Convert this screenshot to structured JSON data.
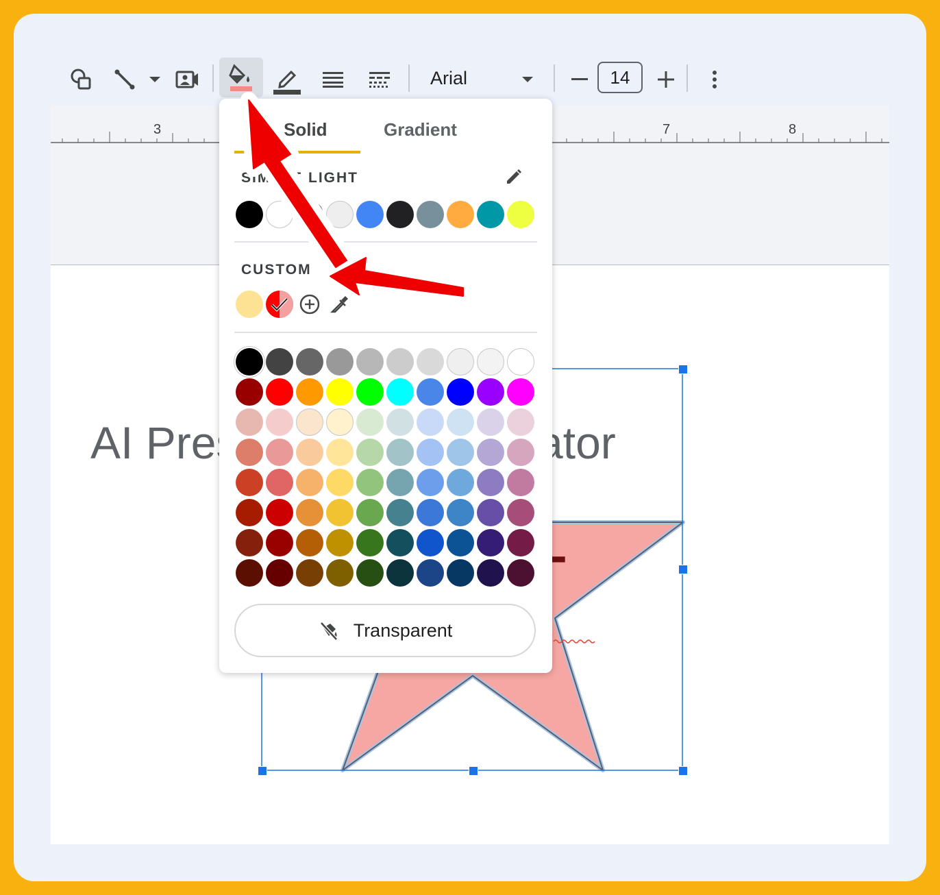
{
  "toolbar": {
    "font_family": "Arial",
    "font_size": "14"
  },
  "ruler": {
    "labels": [
      "3",
      "7",
      "8"
    ]
  },
  "slide": {
    "title": "AI Presentation Generator",
    "shape_text": "T",
    "shape_fill": "#f6a7a3"
  },
  "fill_menu": {
    "tabs": [
      "Solid",
      "Gradient"
    ],
    "active_tab": "Solid",
    "theme_label": "SIMPLE LIGHT",
    "theme_colors": [
      "#000000",
      "#ffffff",
      "#ffffff",
      "#eeeeee",
      "#4285f4",
      "#212124",
      "#78909c",
      "#ffab40",
      "#0097a7",
      "#eeff41"
    ],
    "custom_label": "CUSTOM",
    "custom_colors": [
      "#fde293",
      "#ff0000"
    ],
    "palette": [
      [
        "#000000",
        "#434343",
        "#666666",
        "#999999",
        "#b7b7b7",
        "#cccccc",
        "#d9d9d9",
        "#efefef",
        "#f3f3f3",
        "#ffffff"
      ],
      [
        "#980000",
        "#ff0000",
        "#ff9900",
        "#ffff00",
        "#00ff00",
        "#00ffff",
        "#4a86e8",
        "#0000ff",
        "#9900ff",
        "#ff00ff"
      ],
      [
        "#e6b8af",
        "#f4cccc",
        "#fce5cd",
        "#fff2cc",
        "#d9ead3",
        "#d0e0e3",
        "#c9daf8",
        "#cfe2f3",
        "#d9d2e9",
        "#ead1dc"
      ],
      [
        "#dd7e6b",
        "#ea9999",
        "#f9cb9c",
        "#ffe599",
        "#b6d7a8",
        "#a2c4c9",
        "#a4c2f4",
        "#9fc5e8",
        "#b4a7d6",
        "#d5a6bd"
      ],
      [
        "#cc4125",
        "#e06666",
        "#f6b26b",
        "#ffd966",
        "#93c47d",
        "#76a5af",
        "#6d9eeb",
        "#6fa8dc",
        "#8e7cc3",
        "#c27ba0"
      ],
      [
        "#a61c00",
        "#cc0000",
        "#e69138",
        "#f1c232",
        "#6aa84f",
        "#45818e",
        "#3c78d8",
        "#3d85c6",
        "#674ea7",
        "#a64d79"
      ],
      [
        "#85200c",
        "#990000",
        "#b45f06",
        "#bf9000",
        "#38761d",
        "#134f5c",
        "#1155cc",
        "#0b5394",
        "#351c75",
        "#741b47"
      ],
      [
        "#5b0f00",
        "#660000",
        "#783f04",
        "#7f6000",
        "#274e13",
        "#0c343d",
        "#1c4587",
        "#073763",
        "#20124d",
        "#4c1130"
      ]
    ],
    "transparent_label": "Transparent"
  },
  "colors": {
    "frame_border": "#f9b10f",
    "selection": "#1a73e8",
    "annotation_arrow": "#ee0000"
  }
}
